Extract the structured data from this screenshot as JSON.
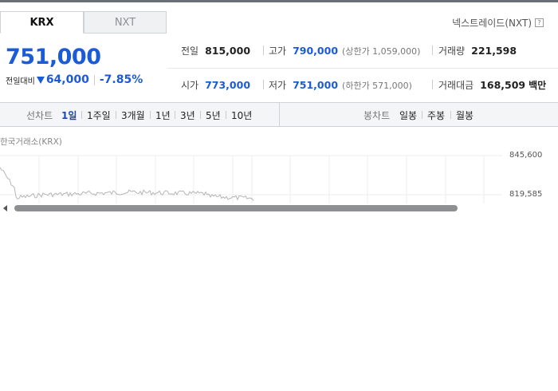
{
  "market_tabs": [
    {
      "label": "KRX",
      "active": true
    },
    {
      "label": "NXT",
      "active": false
    }
  ],
  "nxt_link": {
    "label": "넥스트레이드(NXT)",
    "help_icon": "?"
  },
  "quote": {
    "price": "751,000",
    "change_label": "전일대비",
    "change_icon": "down-triangle-icon",
    "change_value": "64,000",
    "change_percent": "-7.85%"
  },
  "stats": {
    "prev_close": {
      "label": "전일",
      "value": "815,000"
    },
    "high": {
      "label": "고가",
      "value": "790,000",
      "limit": "(상한가 1,059,000)"
    },
    "volume": {
      "label": "거래량",
      "value": "221,598"
    },
    "open": {
      "label": "시가",
      "value": "773,000"
    },
    "low": {
      "label": "저가",
      "value": "751,000",
      "limit": "(하한가 571,000)"
    },
    "amount": {
      "label": "거래대금",
      "value": "168,509",
      "unit": "백만"
    }
  },
  "line_chart_tools": {
    "label": "선차트",
    "periods": [
      "1일",
      "1주일",
      "3개월",
      "1년",
      "3년",
      "5년",
      "10년"
    ],
    "selected": "1일"
  },
  "candle_chart_tools": {
    "label": "봉차트",
    "periods": [
      "일봉",
      "주봉",
      "월봉"
    ]
  },
  "chart": {
    "source": "한국거래소(KRX)",
    "y_ticks": [
      "845,600",
      "819,585"
    ]
  },
  "colors": {
    "accent": "#1b5bd6",
    "down": "#1b5bd6",
    "line": "#b5b5b5"
  }
}
